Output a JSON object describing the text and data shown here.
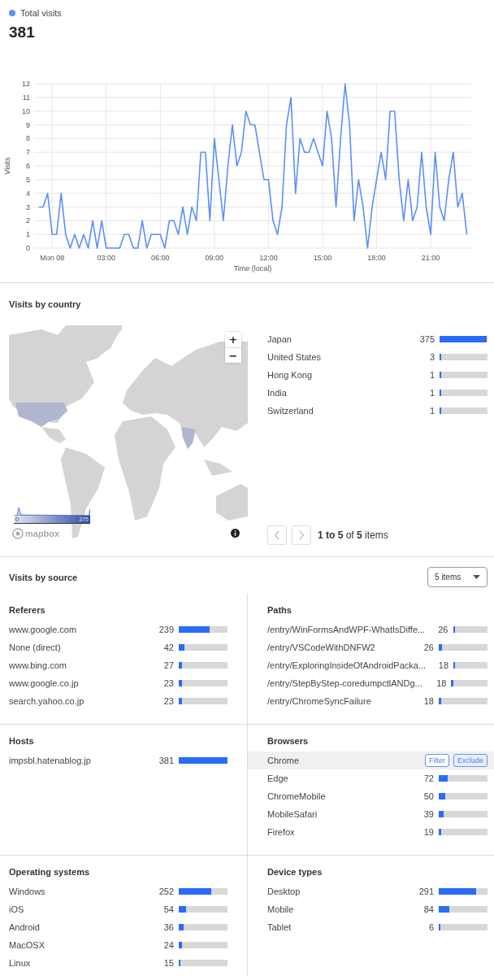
{
  "visits": {
    "total": "381",
    "chart_data": {
      "type": "line",
      "xlabel": "Time (local)",
      "ylabel": "Visits",
      "x": [
        -0.75,
        -0.5,
        -0.25,
        0,
        0.25,
        0.5,
        0.75,
        1,
        1.25,
        1.5,
        1.75,
        2,
        2.25,
        2.5,
        2.75,
        3,
        3.25,
        3.5,
        3.75,
        4,
        4.25,
        4.5,
        4.75,
        5,
        5.25,
        5.5,
        5.75,
        6,
        6.25,
        6.5,
        6.75,
        7,
        7.25,
        7.5,
        7.75,
        8,
        8.25,
        8.5,
        8.75,
        9,
        9.25,
        9.5,
        9.75,
        10,
        10.25,
        10.5,
        10.75,
        11,
        11.25,
        11.5,
        11.75,
        12,
        12.25,
        12.5,
        12.75,
        13,
        13.25,
        13.5,
        13.75,
        14,
        14.25,
        14.5,
        14.75,
        15,
        15.25,
        15.5,
        15.75,
        16,
        16.25,
        16.5,
        16.75,
        17,
        17.25,
        17.5,
        17.75,
        18,
        18.25,
        18.5,
        18.75,
        19,
        19.25,
        19.5,
        19.75,
        20,
        20.25,
        20.5,
        20.75,
        21,
        21.25,
        21.5,
        21.75,
        22,
        22.25,
        22.5,
        22.75,
        23
      ],
      "series": [
        {
          "name": "Total visits",
          "color": "#5b8ff9",
          "values": [
            3,
            3,
            4,
            1,
            1,
            4,
            1,
            0,
            1,
            0,
            1,
            0,
            2,
            0,
            2,
            0,
            0,
            0,
            0,
            1,
            1,
            0,
            0,
            2,
            0,
            1,
            1,
            1,
            0,
            2,
            2,
            1,
            3,
            1,
            3,
            2,
            7,
            7,
            2,
            8,
            5,
            2,
            6,
            9,
            6,
            7,
            10,
            9,
            9,
            7,
            5,
            5,
            2,
            1,
            3,
            9,
            11,
            4,
            8,
            7,
            7,
            8,
            7,
            6,
            10,
            8,
            3,
            8,
            12,
            9,
            2,
            5,
            3,
            0,
            3,
            5,
            7,
            5,
            10,
            10,
            5,
            2,
            5,
            2,
            3,
            7,
            3,
            1,
            7,
            3,
            2,
            5,
            7,
            3,
            4,
            1
          ]
        }
      ],
      "xlim": [
        -1,
        23.25
      ],
      "ylim": [
        0,
        12
      ],
      "grid": true,
      "xticks": [
        {
          "value": 0,
          "label": "Mon 08"
        },
        {
          "value": 3,
          "label": "03:00"
        },
        {
          "value": 6,
          "label": "06:00"
        },
        {
          "value": 9,
          "label": "09:00"
        },
        {
          "value": 12,
          "label": "12:00"
        },
        {
          "value": 15,
          "label": "15:00"
        },
        {
          "value": 18,
          "label": "18:00"
        },
        {
          "value": 21,
          "label": "21:00"
        }
      ],
      "yticks": [
        0,
        1,
        2,
        3,
        4,
        5,
        6,
        7,
        8,
        9,
        10,
        11,
        12
      ]
    }
  },
  "country": {
    "title": "Visits by country",
    "map": {
      "zoom_in": "+",
      "zoom_out": "−",
      "legend_min": "0",
      "legend_max": "375",
      "logo": "mapbox"
    },
    "rows": [
      {
        "name": "Japan",
        "count": "375",
        "level": 0.984
      },
      {
        "name": "United States",
        "count": "3",
        "level": 0.008
      },
      {
        "name": "Hong Kong",
        "count": "1",
        "level": 0.003
      },
      {
        "name": "India",
        "count": "1",
        "level": 0.003
      },
      {
        "name": "Switzerland",
        "count": "1",
        "level": 0.003
      }
    ],
    "pager": {
      "prev_disabled": true,
      "next_disabled": true,
      "summary": "**1 to 5** of **5** items"
    }
  },
  "source": {
    "title": "Visits by source",
    "select": "5 items",
    "panels": [
      {
        "title": "Referers",
        "rows": [
          {
            "name": "www.google.com",
            "count": "239",
            "level": 0.627,
            "hovered": false
          },
          {
            "name": "None (direct)",
            "count": "42",
            "level": 0.11,
            "hovered": false
          },
          {
            "name": "www.bing.com",
            "count": "27",
            "level": 0.071,
            "hovered": false
          },
          {
            "name": "www.google.co.jp",
            "count": "23",
            "level": 0.06,
            "hovered": false
          },
          {
            "name": "search.yahoo.co.jp",
            "count": "23",
            "level": 0.06,
            "hovered": false
          }
        ]
      },
      {
        "title": "Paths",
        "rows": [
          {
            "name": "/entry/WinFormsAndWPF-WhatIsDiffe...",
            "count": "26",
            "level": 0.068,
            "hovered": false
          },
          {
            "name": "/entry/VSCodeWithDNFW2",
            "count": "26",
            "level": 0.068,
            "hovered": false
          },
          {
            "name": "/entry/ExploringInsideOfAndroidPacka...",
            "count": "18",
            "level": 0.047,
            "hovered": false
          },
          {
            "name": "/entry/StepByStep-coredumpctlANDg...",
            "count": "18",
            "level": 0.047,
            "hovered": false
          },
          {
            "name": "/entry/ChromeSyncFailure",
            "count": "18",
            "level": 0.047,
            "hovered": false
          }
        ]
      },
      {
        "title": "Hosts",
        "rows": [
          {
            "name": "impsbl.hatenablog.jp",
            "count": "381",
            "level": 1,
            "hovered": false
          }
        ]
      },
      {
        "title": "Browsers",
        "rows": [
          {
            "name": "Chrome",
            "hovered": true,
            "actions": [
              "Filter",
              "Exclude"
            ]
          },
          {
            "name": "Edge",
            "count": "72",
            "level": 0.189,
            "hovered": false
          },
          {
            "name": "ChromeMobile",
            "count": "50",
            "level": 0.131,
            "hovered": false
          },
          {
            "name": "MobileSafari",
            "count": "39",
            "level": 0.102,
            "hovered": false
          },
          {
            "name": "Firefox",
            "count": "19",
            "level": 0.05,
            "hovered": false
          }
        ]
      },
      {
        "title": "Operating systems",
        "rows": [
          {
            "name": "Windows",
            "count": "252",
            "level": 0.661,
            "hovered": false
          },
          {
            "name": "iOS",
            "count": "54",
            "level": 0.142,
            "hovered": false
          },
          {
            "name": "Android",
            "count": "36",
            "level": 0.094,
            "hovered": false
          },
          {
            "name": "MacOSX",
            "count": "24",
            "level": 0.063,
            "hovered": false
          },
          {
            "name": "Linux",
            "count": "15",
            "level": 0.039,
            "hovered": false
          }
        ]
      },
      {
        "title": "Device types",
        "rows": [
          {
            "name": "Desktop",
            "count": "291",
            "level": 0.764,
            "hovered": false
          },
          {
            "name": "Mobile",
            "count": "84",
            "level": 0.22,
            "hovered": false
          },
          {
            "name": "Tablet",
            "count": "6",
            "level": 0.016,
            "hovered": false
          }
        ]
      }
    ]
  }
}
